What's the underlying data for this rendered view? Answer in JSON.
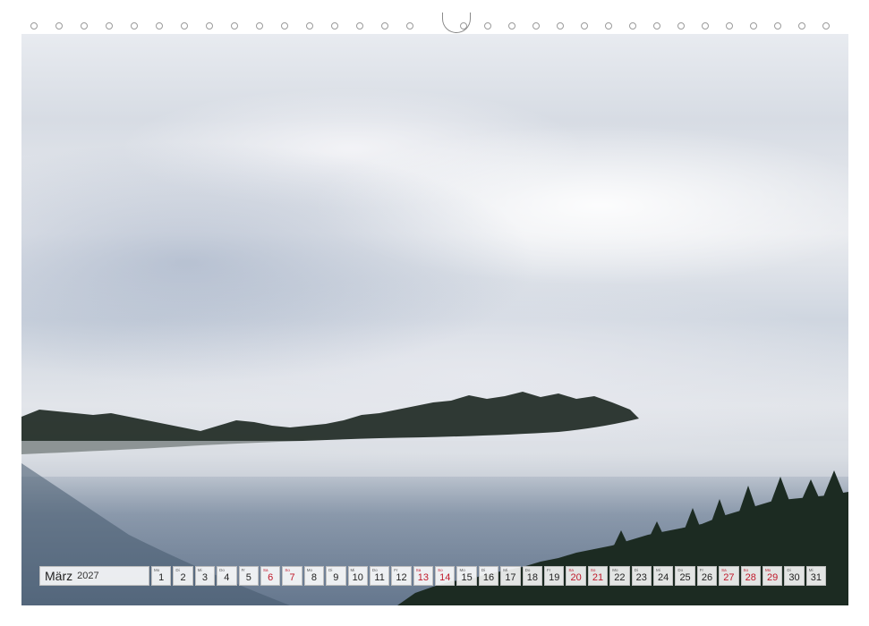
{
  "calendar": {
    "month": "März",
    "year": "2027",
    "days": [
      {
        "n": "1",
        "wd": "Mo",
        "we": false
      },
      {
        "n": "2",
        "wd": "Di",
        "we": false
      },
      {
        "n": "3",
        "wd": "Mi",
        "we": false
      },
      {
        "n": "4",
        "wd": "Do",
        "we": false
      },
      {
        "n": "5",
        "wd": "Fr",
        "we": false
      },
      {
        "n": "6",
        "wd": "Sa",
        "we": true
      },
      {
        "n": "7",
        "wd": "So",
        "we": true
      },
      {
        "n": "8",
        "wd": "Mo",
        "we": false
      },
      {
        "n": "9",
        "wd": "Di",
        "we": false
      },
      {
        "n": "10",
        "wd": "Mi",
        "we": false
      },
      {
        "n": "11",
        "wd": "Do",
        "we": false
      },
      {
        "n": "12",
        "wd": "Fr",
        "we": false
      },
      {
        "n": "13",
        "wd": "Sa",
        "we": true
      },
      {
        "n": "14",
        "wd": "So",
        "we": true
      },
      {
        "n": "15",
        "wd": "Mo",
        "we": false
      },
      {
        "n": "16",
        "wd": "Di",
        "we": false
      },
      {
        "n": "17",
        "wd": "Mi",
        "we": false
      },
      {
        "n": "18",
        "wd": "Do",
        "we": false
      },
      {
        "n": "19",
        "wd": "Fr",
        "we": false
      },
      {
        "n": "20",
        "wd": "Sa",
        "we": true
      },
      {
        "n": "21",
        "wd": "So",
        "we": true
      },
      {
        "n": "22",
        "wd": "Mo",
        "we": false
      },
      {
        "n": "23",
        "wd": "Di",
        "we": false
      },
      {
        "n": "24",
        "wd": "Mi",
        "we": false
      },
      {
        "n": "25",
        "wd": "Do",
        "we": false
      },
      {
        "n": "26",
        "wd": "Fr",
        "we": false
      },
      {
        "n": "27",
        "wd": "Sa",
        "we": true
      },
      {
        "n": "28",
        "wd": "So",
        "we": true
      },
      {
        "n": "29",
        "wd": "Mo",
        "we": true
      },
      {
        "n": "30",
        "wd": "Di",
        "we": false
      },
      {
        "n": "31",
        "wd": "Mi",
        "we": false
      }
    ]
  },
  "colors": {
    "weekend": "#c0182a",
    "text": "#222222",
    "forest": "#1f2a24"
  }
}
